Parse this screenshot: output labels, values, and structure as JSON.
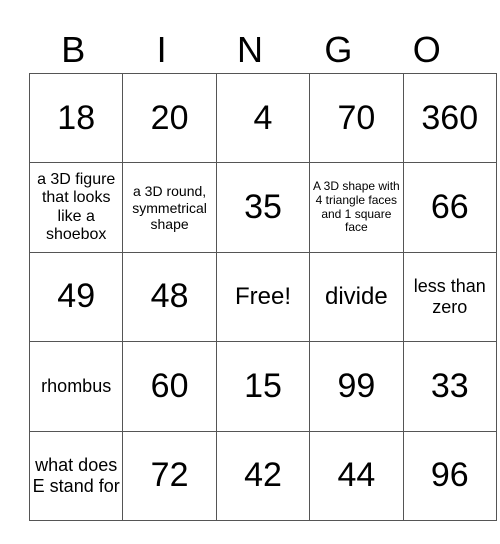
{
  "header": [
    "B",
    "I",
    "N",
    "G",
    "O"
  ],
  "rows": [
    [
      "18",
      "20",
      "4",
      "70",
      "360"
    ],
    [
      "a 3D figure that looks like a shoebox",
      "a 3D round, symmetrical shape",
      "35",
      "A 3D shape with 4 triangle faces and 1 square face",
      "66"
    ],
    [
      "49",
      "48",
      "Free!",
      "divide",
      "less than zero"
    ],
    [
      "rhombus",
      "60",
      "15",
      "99",
      "33"
    ],
    [
      "what does E stand for",
      "72",
      "42",
      "44",
      "96"
    ]
  ]
}
